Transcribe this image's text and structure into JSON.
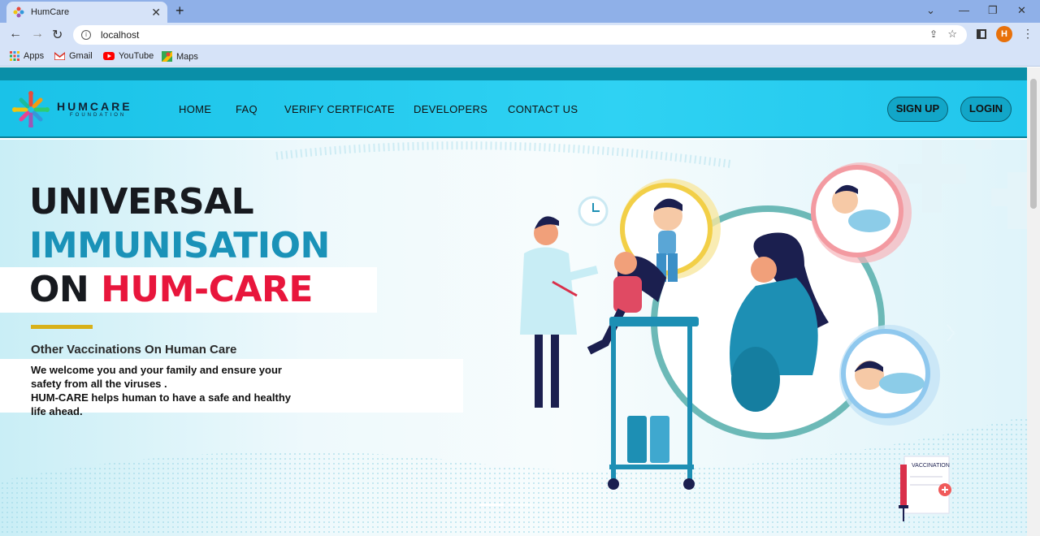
{
  "browser": {
    "tab_title": "HumCare",
    "url": "localhost",
    "profile_initial": "H",
    "bookmarks": [
      {
        "label": "Apps",
        "icon": "apps-grid-icon"
      },
      {
        "label": "Gmail",
        "icon": "gmail-icon"
      },
      {
        "label": "YouTube",
        "icon": "youtube-icon"
      },
      {
        "label": "Maps",
        "icon": "maps-icon"
      }
    ]
  },
  "site": {
    "brand": "HUMCARE",
    "brand_sub": "FOUNDATION",
    "nav": [
      "HOME",
      "FAQ",
      "VERIFY CERTFICATE",
      "DEVELOPERS",
      "CONTACT US"
    ],
    "signup": "SIGN UP",
    "login": "LOGIN"
  },
  "hero": {
    "line1": "UNIVERSAL",
    "line2": "IMMUNISATION",
    "line3_prefix": "ON",
    "line3_accent": "HUM-CARE",
    "subtitle": "Other Vaccinations On  Human Care",
    "para1": "We welcome you and your family and ensure your safety from all the viruses .",
    "para2": "HUM-CARE helps human to have a safe and healthy life ahead.",
    "vaccination_label": "VACCINATION"
  },
  "colors": {
    "brand_cyan": "#1ac2e8",
    "accent_red": "#e8163c",
    "accent_teal": "#1aa0c4",
    "gold": "#d8b119"
  }
}
